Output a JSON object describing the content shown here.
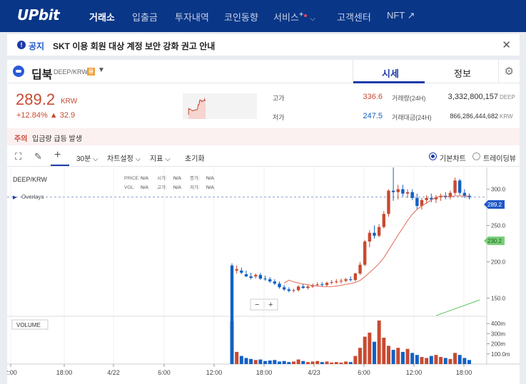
{
  "nav": {
    "logo": "UPbit",
    "items": [
      "거래소",
      "입출금",
      "투자내역",
      "코인동향",
      "서비스",
      "고객센터",
      "NFT ↗"
    ],
    "service_plus": "+"
  },
  "notice": {
    "tag": "공지",
    "text": "SKT 이용 회원 대상 계정 보안 강화 권고 안내"
  },
  "coin": {
    "name": "딥북",
    "pair": "DEEP/KRW",
    "flag": "유",
    "tabs": [
      "시세",
      "정보"
    ]
  },
  "price": {
    "value": "289.2",
    "unit": "KRW",
    "change_pct": "+12.84%",
    "change_amt": "▲ 32.9"
  },
  "stats": {
    "high_label": "고가",
    "high": "336.6",
    "low_label": "저가",
    "low": "247.5",
    "volume_label": "거래량(24H)",
    "volume": "3,332,800,157",
    "volume_unit": "DEEP",
    "amount_label": "거래대금(24H)",
    "amount": "866,286,444,682",
    "amount_unit": "KRW"
  },
  "warning": {
    "tag": "주의",
    "text": "입금량 급등 발생"
  },
  "toolbar": {
    "interval": "30분",
    "chart_settings": "차트설정",
    "indicator": "지표",
    "reset": "초기화",
    "basic_chart": "기본차트",
    "trading_view": "트레이딩뷰"
  },
  "chart_info": {
    "symbol": "DEEP/KRW",
    "overlays": "Overlays",
    "ohlc_labels": [
      "PRICE:",
      "시가:",
      "종가:",
      "VOL:",
      "고가:",
      "저가:"
    ],
    "ohlc_values": [
      "N/A",
      "N/A",
      "N/A",
      "N/A",
      "N/A",
      "N/A"
    ],
    "volume_label": "VOLUME",
    "zoom_minus": "−",
    "zoom_plus": "+",
    "current_price_tag": "289.2",
    "ma_tag": "230.2"
  },
  "chart_data": {
    "type": "candlestick",
    "symbol": "DEEP/KRW",
    "x_ticks": [
      "2:00",
      "18:00",
      "4/22",
      "6:00",
      "12:00",
      "18:00",
      "4/23",
      "6:00",
      "12:00",
      "18:00"
    ],
    "y_ticks": [
      300.0,
      250.0,
      200.0,
      150.0
    ],
    "volume_ticks": [
      "400m",
      "300m",
      "200m",
      "100.0m"
    ],
    "ylim": [
      125,
      330
    ],
    "current_price": 289.2,
    "ma_value": 230.2,
    "candles": [
      [
        195,
        198,
        110,
        110
      ],
      [
        188,
        195,
        184,
        190
      ],
      [
        188,
        192,
        183,
        185
      ],
      [
        183,
        188,
        179,
        180
      ],
      [
        180,
        185,
        176,
        178
      ],
      [
        180,
        184,
        177,
        182
      ],
      [
        182,
        185,
        175,
        177
      ],
      [
        177,
        181,
        174,
        176
      ],
      [
        176,
        179,
        171,
        173
      ],
      [
        173,
        176,
        168,
        170
      ],
      [
        170,
        173,
        163,
        165
      ],
      [
        165,
        168,
        160,
        162
      ],
      [
        162,
        165,
        158,
        160
      ],
      [
        160,
        163,
        158,
        161
      ],
      [
        161,
        168,
        159,
        166
      ],
      [
        166,
        170,
        163,
        164
      ],
      [
        164,
        168,
        162,
        166
      ],
      [
        166,
        170,
        164,
        168
      ],
      [
        168,
        172,
        166,
        169
      ],
      [
        169,
        172,
        166,
        168
      ],
      [
        168,
        173,
        166,
        171
      ],
      [
        171,
        175,
        169,
        172
      ],
      [
        172,
        176,
        170,
        173
      ],
      [
        173,
        177,
        170,
        174
      ],
      [
        174,
        178,
        172,
        176
      ],
      [
        176,
        180,
        173,
        175
      ],
      [
        175,
        185,
        173,
        184
      ],
      [
        184,
        200,
        182,
        196
      ],
      [
        196,
        230,
        194,
        228
      ],
      [
        228,
        244,
        220,
        240
      ],
      [
        240,
        250,
        232,
        236
      ],
      [
        236,
        252,
        234,
        248
      ],
      [
        248,
        270,
        246,
        266
      ],
      [
        266,
        300,
        262,
        298
      ],
      [
        298,
        332,
        284,
        296
      ],
      [
        296,
        306,
        286,
        300
      ],
      [
        300,
        306,
        290,
        294
      ],
      [
        294,
        300,
        288,
        296
      ],
      [
        296,
        300,
        285,
        288
      ],
      [
        288,
        294,
        272,
        277
      ],
      [
        277,
        288,
        272,
        285
      ],
      [
        285,
        292,
        280,
        288
      ],
      [
        288,
        294,
        282,
        286
      ],
      [
        286,
        292,
        281,
        289
      ],
      [
        289,
        294,
        284,
        291
      ],
      [
        291,
        296,
        286,
        289
      ],
      [
        289,
        298,
        286,
        295
      ],
      [
        295,
        316,
        292,
        312
      ],
      [
        312,
        314,
        292,
        295
      ],
      [
        295,
        300,
        288,
        291
      ],
      [
        291,
        294,
        286,
        289
      ]
    ],
    "volumes": [
      420,
      120,
      80,
      60,
      50,
      40,
      45,
      30,
      35,
      40,
      25,
      30,
      20,
      25,
      45,
      30,
      20,
      25,
      30,
      20,
      25,
      15,
      20,
      15,
      25,
      20,
      80,
      160,
      270,
      310,
      220,
      430,
      260,
      180,
      140,
      160,
      120,
      150,
      110,
      90,
      70,
      60,
      80,
      90,
      70,
      60,
      50,
      110,
      90,
      60,
      40
    ]
  },
  "colors": {
    "up": "#c84a31",
    "down": "#1261c4",
    "nav_bg": "#093687",
    "ma_line": "#e06a55",
    "green_line": "#5cc45c"
  }
}
